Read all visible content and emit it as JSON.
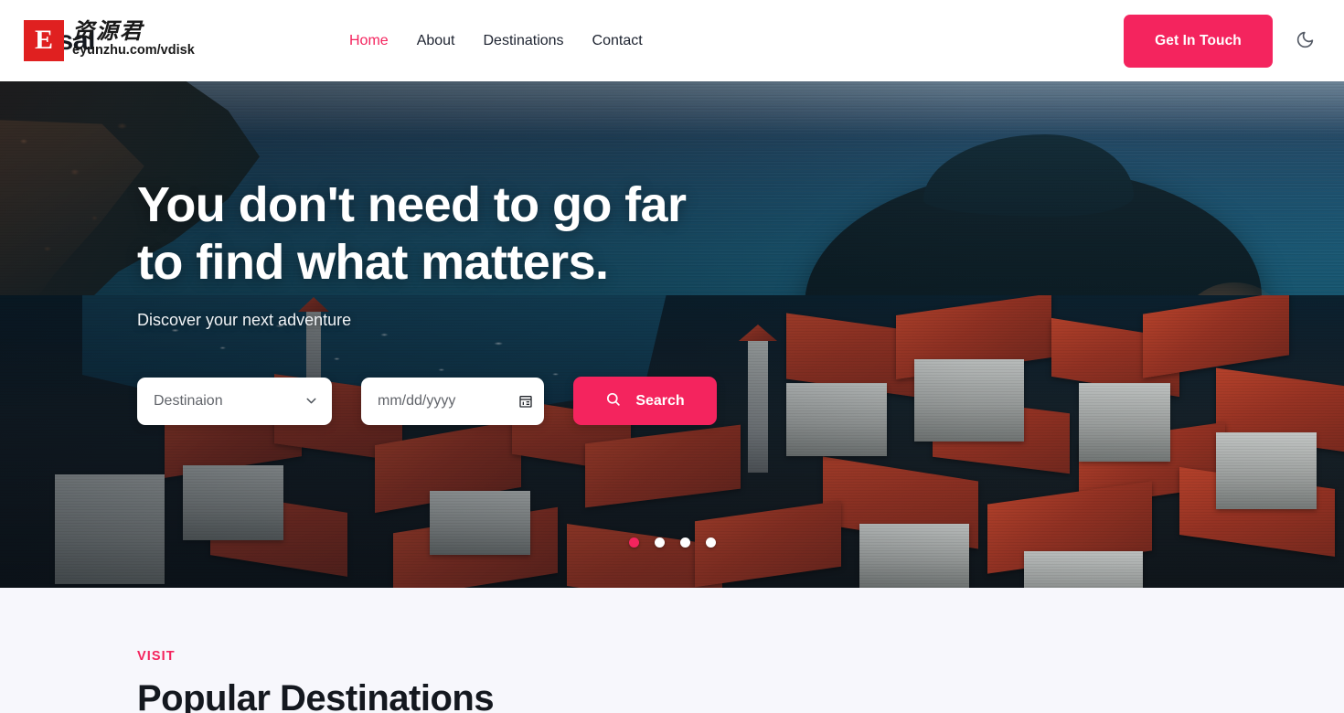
{
  "header": {
    "brand_text": "ersal",
    "watermark": {
      "badge_letter": "E",
      "cn_text": "资源君",
      "url_text": "eyunzhu.com/vdisk"
    },
    "nav": [
      {
        "label": "Home",
        "active": true
      },
      {
        "label": "About",
        "active": false
      },
      {
        "label": "Destinations",
        "active": false
      },
      {
        "label": "Contact",
        "active": false
      }
    ],
    "cta_label": "Get In Touch",
    "theme_toggle_icon": "moon-icon"
  },
  "hero": {
    "title": "You don't need to go far to find what matters.",
    "subtitle": "Discover your next adventure",
    "search": {
      "destination_value": "Destinaion",
      "destination_icon": "chevron-down-icon",
      "date_placeholder": "mm/dd/yyyy",
      "date_value": "",
      "date_icon": "calendar-icon",
      "search_label": "Search",
      "search_icon": "search-icon"
    },
    "carousel": {
      "total": 4,
      "active_index": 0
    }
  },
  "section": {
    "eyebrow": "VISIT",
    "title": "Popular Destinations"
  },
  "colors": {
    "accent": "#f4245e",
    "text_dark": "#14181f",
    "page_bg": "#f7f7fc",
    "watermark_red": "#e02020"
  }
}
